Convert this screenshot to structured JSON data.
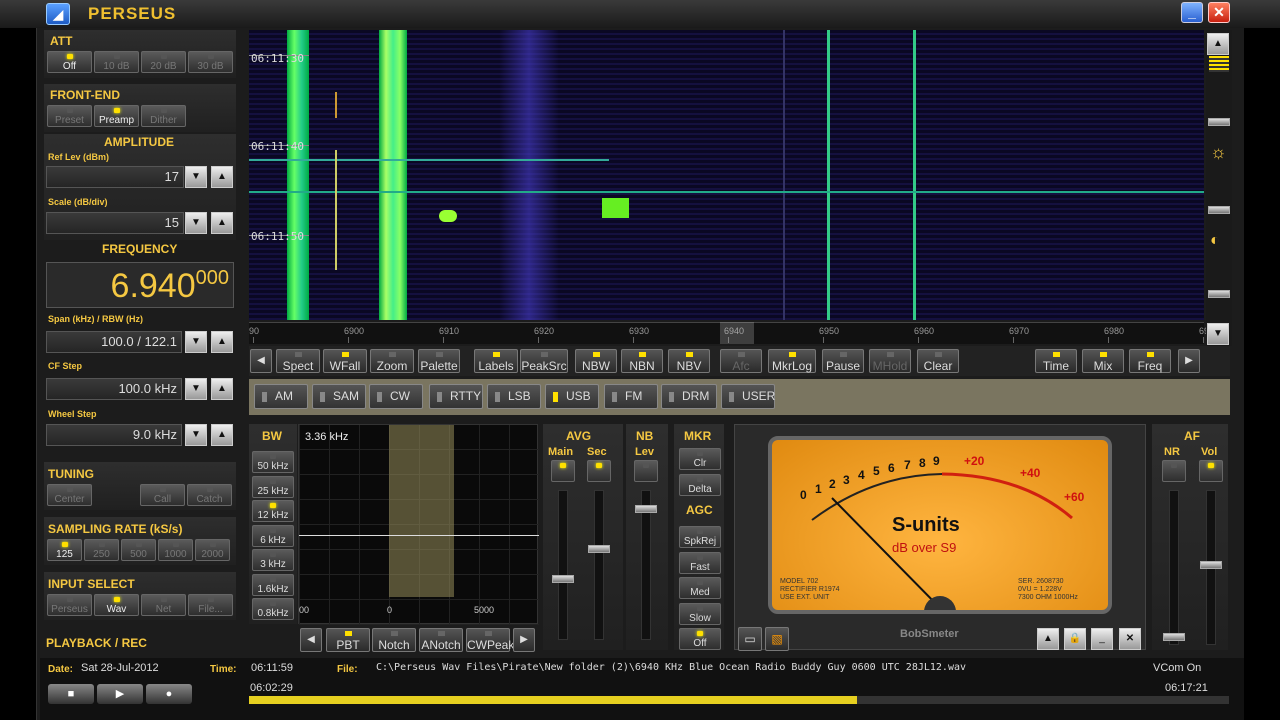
{
  "titlebar": {
    "title": "PERSEUS",
    "minimize": "_",
    "close": "✕"
  },
  "att": {
    "title": "ATT",
    "buttons": [
      "Off",
      "10 dB",
      "20 dB",
      "30 dB"
    ],
    "active": 0
  },
  "frontend": {
    "title": "FRONT-END",
    "buttons": [
      "Preset",
      "Preamp",
      "Dither"
    ],
    "active": 1
  },
  "amplitude": {
    "title": "AMPLITUDE",
    "ref_label": "Ref Lev (dBm)",
    "ref_value": "17",
    "scale_label": "Scale (dB/div)",
    "scale_value": "15"
  },
  "frequency": {
    "title": "FREQUENCY",
    "main": "6.940",
    "sub": "000",
    "span_label": "Span (kHz) / RBW (Hz)",
    "span_value": "100.0 / 122.1",
    "cf_label": "CF Step",
    "cf_value": "100.0 kHz",
    "wheel_label": "Wheel Step",
    "wheel_value": "9.0 kHz"
  },
  "tuning": {
    "title": "TUNING",
    "buttons": [
      "Center",
      "Call",
      "Catch"
    ]
  },
  "sampling": {
    "title": "SAMPLING RATE (kS/s)",
    "buttons": [
      "125",
      "250",
      "500",
      "1000",
      "2000"
    ],
    "active": 0
  },
  "input": {
    "title": "INPUT SELECT",
    "buttons": [
      "Perseus",
      "Wav",
      "Net",
      "File..."
    ],
    "active": 1
  },
  "playback": {
    "title": "PLAYBACK / REC"
  },
  "waterfall": {
    "times": [
      "06:11:30",
      "06:11:40",
      "06:11:50"
    ]
  },
  "scale": {
    "ticks": [
      "90",
      "6900",
      "6910",
      "6920",
      "6930",
      "6940",
      "6950",
      "6960",
      "6970",
      "6980",
      "69"
    ]
  },
  "toolbar": {
    "buttons": [
      "Spect",
      "WFall",
      "Zoom",
      "Palette",
      "Labels",
      "PeakSrc",
      "NBW",
      "NBN",
      "NBV",
      "Afc",
      "MkrLog",
      "Pause",
      "MHold",
      "Clear",
      "Time",
      "Mix",
      "Freq"
    ]
  },
  "modes": {
    "buttons": [
      "AM",
      "SAM",
      "CW",
      "RTTY",
      "LSB",
      "USB",
      "FM",
      "DRM",
      "USER"
    ],
    "active": 5
  },
  "bw": {
    "title": "BW",
    "value": "3.36 kHz",
    "buttons": [
      "50 kHz",
      "25 kHz",
      "12 kHz",
      "6 kHz",
      "3 kHz",
      "1.6kHz",
      "0.8kHz"
    ],
    "axis": [
      "00",
      "0",
      "5000"
    ]
  },
  "filters": {
    "buttons": [
      "PBT",
      "Notch",
      "ANotch",
      "CWPeak"
    ]
  },
  "avg": {
    "title": "AVG",
    "main": "Main",
    "sec": "Sec"
  },
  "nb": {
    "title": "NB",
    "lev": "Lev"
  },
  "mkr": {
    "title": "MKR",
    "buttons": [
      "Clr",
      "Delta"
    ]
  },
  "agc": {
    "title": "AGC",
    "buttons": [
      "SpkRej",
      "Fast",
      "Med",
      "Slow",
      "Off"
    ]
  },
  "meter": {
    "title": "S-units",
    "subtitle": "dB over S9",
    "scale": [
      "0",
      "1",
      "2",
      "3",
      "4",
      "5",
      "6",
      "7",
      "8",
      "9"
    ],
    "over": [
      "+20",
      "+40",
      "+60"
    ],
    "model": "MODEL 702\nRECTIFIER R1974\nUSE EXT. UNIT",
    "ser": "SER. 2608730\n0VU = 1.228V\n7300 OHM 1000Hz",
    "name": "BobSmeter"
  },
  "af": {
    "title": "AF",
    "nr": "NR",
    "vol": "Vol"
  },
  "status": {
    "date_label": "Date:",
    "date": "Sat 28-Jul-2012",
    "time_label": "Time:",
    "time": "06:11:59",
    "file_label": "File:",
    "file": "C:\\Perseus Wav Files\\Pirate\\New folder (2)\\6940 KHz Blue Ocean Radio Buddy Guy 0600 UTC 28JL12.wav",
    "vcom": "VCom On",
    "start": "06:02:29",
    "end": "06:17:21",
    "progress": 0.62
  }
}
